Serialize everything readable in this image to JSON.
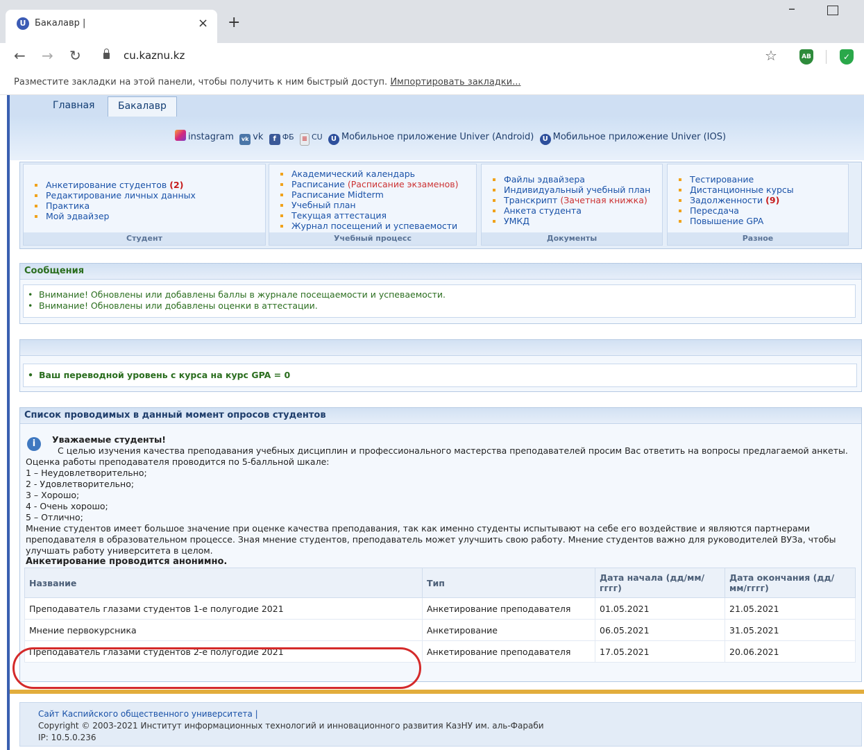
{
  "browser": {
    "tab_title": "Бакалавр |",
    "tab_icon": "U",
    "close_glyph": "×",
    "newtab_glyph": "+",
    "win_min_glyph": "–",
    "back_glyph": "←",
    "forward_glyph": "→",
    "reload_glyph": "↻",
    "url": "cu.kaznu.kz",
    "star_glyph": "☆",
    "ext_adblock": "AB",
    "ext_shield": "✓",
    "bookmarks_text": "Разместите закладки на этой панели, чтобы получить к ним быстрый доступ.",
    "bookmarks_link": "Импортировать закладки..."
  },
  "nav": {
    "tabs": [
      {
        "label": "Главная"
      },
      {
        "label": "Бакалавр"
      }
    ]
  },
  "social": {
    "instagram": "instagram",
    "vk": "vk",
    "fb": "ФБ",
    "cu": "CU",
    "android": "Мобильное приложение Univer (Android)",
    "ios": "Мобильное приложение Univer (IOS)",
    "vk_icon": "vk",
    "fb_icon": "f",
    "cu_icon": "≡",
    "univer_icon": "U"
  },
  "menu": {
    "student": {
      "title": "Студент",
      "items": [
        {
          "label": "Анкетирование студентов",
          "badge": "(2)"
        },
        {
          "label": "Редактирование личных данных"
        },
        {
          "label": "Практика"
        },
        {
          "label": "Мой эдвайзер"
        }
      ]
    },
    "process": {
      "title": "Учебный процесс",
      "items": [
        {
          "label": "Академический календарь"
        },
        {
          "label": "Расписание",
          "extra": "(Расписание экзаменов)"
        },
        {
          "label": "Расписание Midterm"
        },
        {
          "label": "Учебный план"
        },
        {
          "label": "Текущая аттестация"
        },
        {
          "label": "Журнал посещений и успеваемости"
        }
      ]
    },
    "documents": {
      "title": "Документы",
      "items": [
        {
          "label": "Файлы эдвайзера"
        },
        {
          "label": "Индивидуальный учебный план"
        },
        {
          "label": "Транскрипт",
          "extra": "(Зачетная книжка)"
        },
        {
          "label": "Анкета студента"
        },
        {
          "label": "УМКД"
        }
      ]
    },
    "misc": {
      "title": "Разное",
      "items": [
        {
          "label": "Тестирование"
        },
        {
          "label": "Дистанционные курсы"
        },
        {
          "label": "Задолженности",
          "badge": "(9)"
        },
        {
          "label": "Пересдача"
        },
        {
          "label": "Повышение GPA"
        }
      ]
    }
  },
  "messages": {
    "title": "Сообщения",
    "items": [
      "Внимание! Обновлены или добавлены баллы в журнале посещаемости и успеваемости.",
      "Внимание! Обновлены или добавлены оценки в аттестации."
    ]
  },
  "gpa": {
    "text": "Ваш переводной уровень с курса на курс GPA = 0"
  },
  "survey": {
    "title": "Список проводимых в данный момент опросов студентов",
    "info_icon": "i",
    "greeting": "Уважаемые студенты!",
    "intro": "С целью изучения качества преподавания учебных дисциплин и профессионального мастерства преподавателей просим Вас ответить на вопросы предлагаемой анкеты.",
    "scale_intro": "Оценка работы преподавателя проводится по 5-балльной шкале:",
    "scale": [
      "1 – Неудовлетворительно;",
      "2 - Удовлетворительно;",
      "3 – Хорошо;",
      "4 - Очень хорошо;",
      "5 – Отлично;"
    ],
    "importance": "Мнение студентов имеет большое значение при оценке качества преподавания, так как именно студенты испытывают на себе его воздействие и являются партнерами преподавателя в образовательном процессе. Зная мнение студентов, преподаватель может улучшить свою работу. Мнение студентов важно для руководителей ВУЗа, чтобы улучшать работу университета в целом.",
    "anonymous": "Анкетирование проводится анонимно.",
    "columns": [
      "Название",
      "Тип",
      "Дата начала (дд/мм/гггг)",
      "Дата окончания (дд/мм/гггг)"
    ],
    "rows": [
      [
        "Преподаватель глазами студентов 1-е полугодие 2021",
        "Анкетирование преподавателя",
        "01.05.2021",
        "21.05.2021"
      ],
      [
        "Мнение первокурсника",
        "Анкетирование",
        "06.05.2021",
        "31.05.2021"
      ],
      [
        "Преподаватель глазами студентов 2-е полугодие 2021",
        "Анкетирование преподавателя",
        "17.05.2021",
        "20.06.2021"
      ]
    ]
  },
  "footer": {
    "site": "Сайт Каспийского общественного университета |",
    "copyright": "Copyright © 2003-2021 Институт информационных технологий и инновационного развития КазНУ им. аль-Фараби",
    "ip": "IP: 10.5.0.236"
  }
}
